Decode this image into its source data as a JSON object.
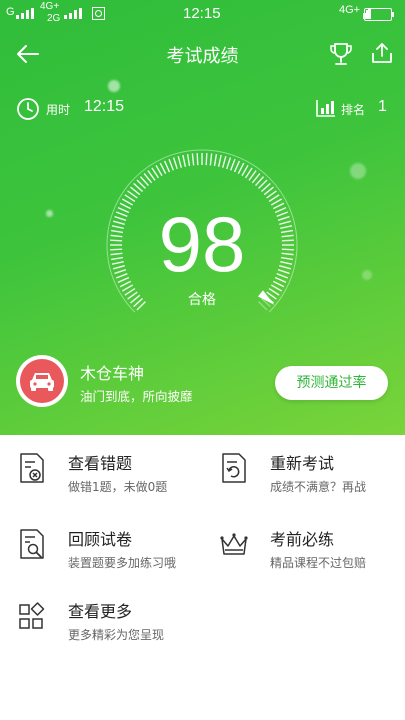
{
  "status_bar": {
    "left_signal_1": "G",
    "left_network": "4G+",
    "left_network_2": "2G",
    "time": "12:15",
    "right_network": "4G+"
  },
  "header": {
    "title": "考试成绩",
    "icons": [
      "back-arrow-icon",
      "trophy-icon",
      "share-icon"
    ]
  },
  "meta": {
    "time_label": "用时",
    "time_value": "12:15",
    "rank_label": "排名",
    "rank_value": "1"
  },
  "result": {
    "score": "98",
    "status": "合格",
    "score_fraction": 0.98
  },
  "user": {
    "name": "木仓车神",
    "motto": "油门到底，所向披靡",
    "predict_button": "预测通过率"
  },
  "menu": [
    {
      "title": "查看错题",
      "sub": "做错1题，未做0题",
      "icon": "wrong-answers-icon"
    },
    {
      "title": "重新考试",
      "sub": "成绩不满意？再战",
      "icon": "retake-exam-icon"
    },
    {
      "title": "回顾试卷",
      "sub": "装置题要多加练习哦",
      "icon": "review-paper-icon"
    },
    {
      "title": "考前必练",
      "sub": "精品课程不过包赔",
      "icon": "crown-icon"
    },
    {
      "title": "查看更多",
      "sub": "更多精彩为您呈现",
      "icon": "more-grid-icon"
    }
  ],
  "colors": {
    "hero_green": "#3ec43c",
    "accent_green": "#2fb53a",
    "avatar_red": "#e9585a"
  }
}
